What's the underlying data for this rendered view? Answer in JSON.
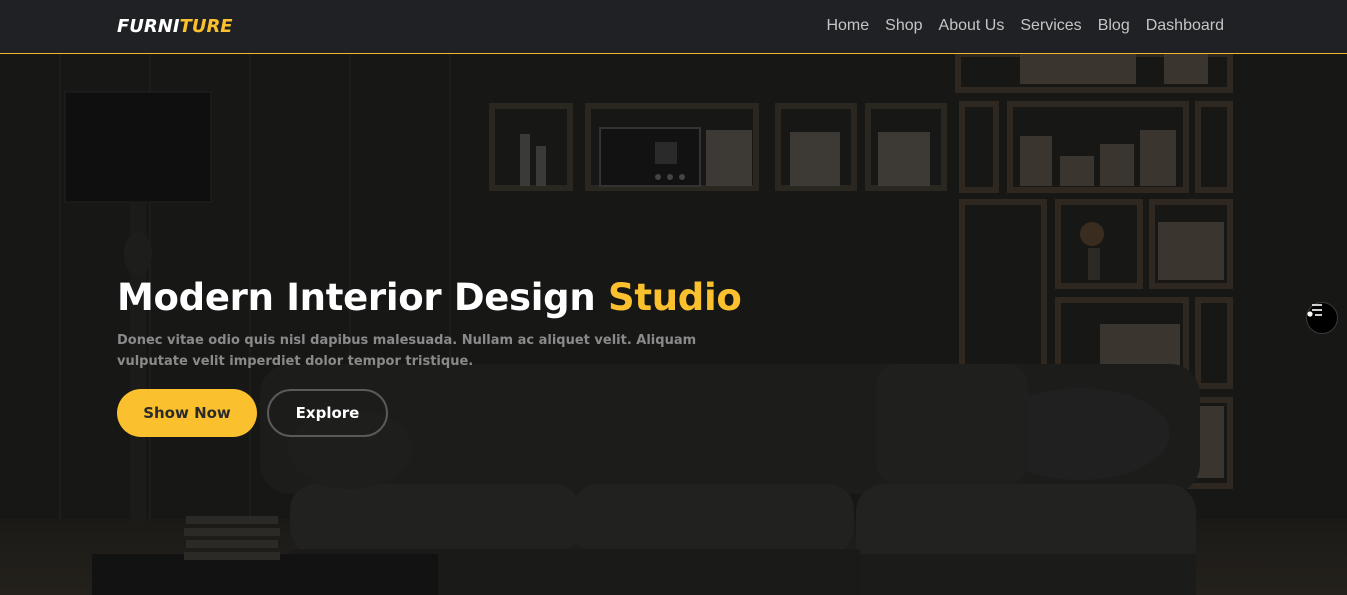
{
  "brand": {
    "part1": "FURNI",
    "part2": "TURE"
  },
  "nav": {
    "items": [
      "Home",
      "Shop",
      "About Us",
      "Services",
      "Blog",
      "Dashboard"
    ]
  },
  "hero": {
    "title_main": "Modern Interior Design ",
    "title_accent": "Studio",
    "description": "Donec vitae odio quis nisl dapibus malesuada. Nullam ac aliquet velit. Aliquam vulputate velit imperdiet dolor tempor tristique.",
    "primary_button": "Show Now",
    "secondary_button": "Explore"
  },
  "floating_button": {
    "icon": "menu-list-icon"
  },
  "colors": {
    "accent": "#fbc02d",
    "nav_bg": "#1f2125",
    "hero_bg": "#171717"
  }
}
